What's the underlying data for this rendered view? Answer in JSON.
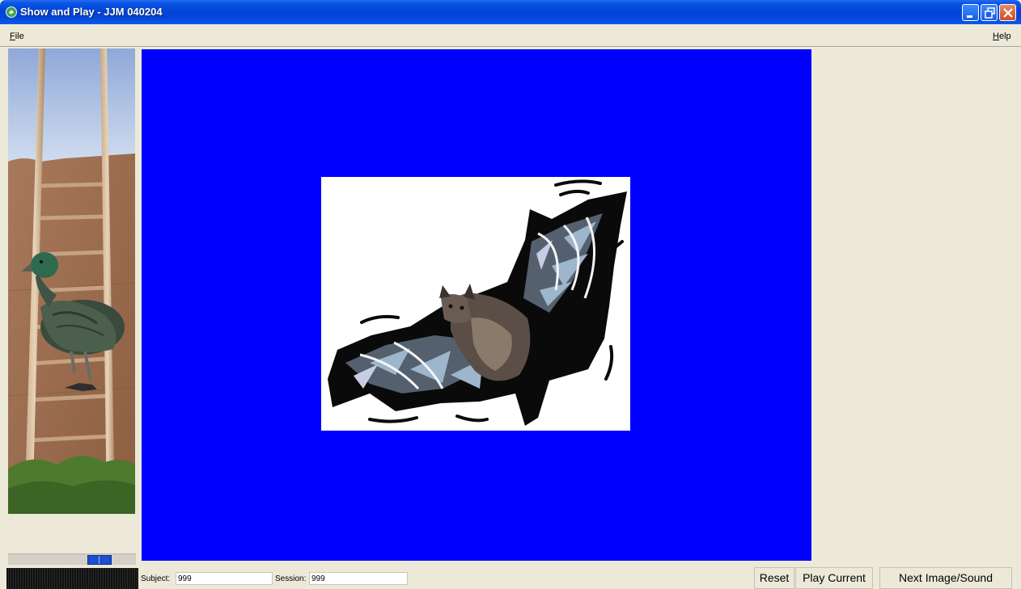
{
  "window": {
    "title": "Show and Play - JJM 040204",
    "icon": "app-icon",
    "controls": [
      "minimize-icon",
      "maximize-icon",
      "close-icon"
    ]
  },
  "menu": {
    "file": {
      "label": "File",
      "accel": "F",
      "rest": "ile"
    },
    "help": {
      "label": "Help",
      "accel": "H",
      "rest": "elp"
    }
  },
  "colors": {
    "stage_background": "#0000FF",
    "titlebar": "#0245D8",
    "window_background": "#ECE9D8"
  },
  "stimulus": {
    "icon": "bat-clipart"
  },
  "side_image": {
    "icon": "duck-on-ladder-photo"
  },
  "fields": {
    "subject": {
      "label": "Subject:",
      "value": "999"
    },
    "session": {
      "label": "Session:",
      "value": "999"
    }
  },
  "buttons": {
    "reset": "Reset",
    "play_current": "Play Current",
    "next": "Next Image/Sound"
  }
}
